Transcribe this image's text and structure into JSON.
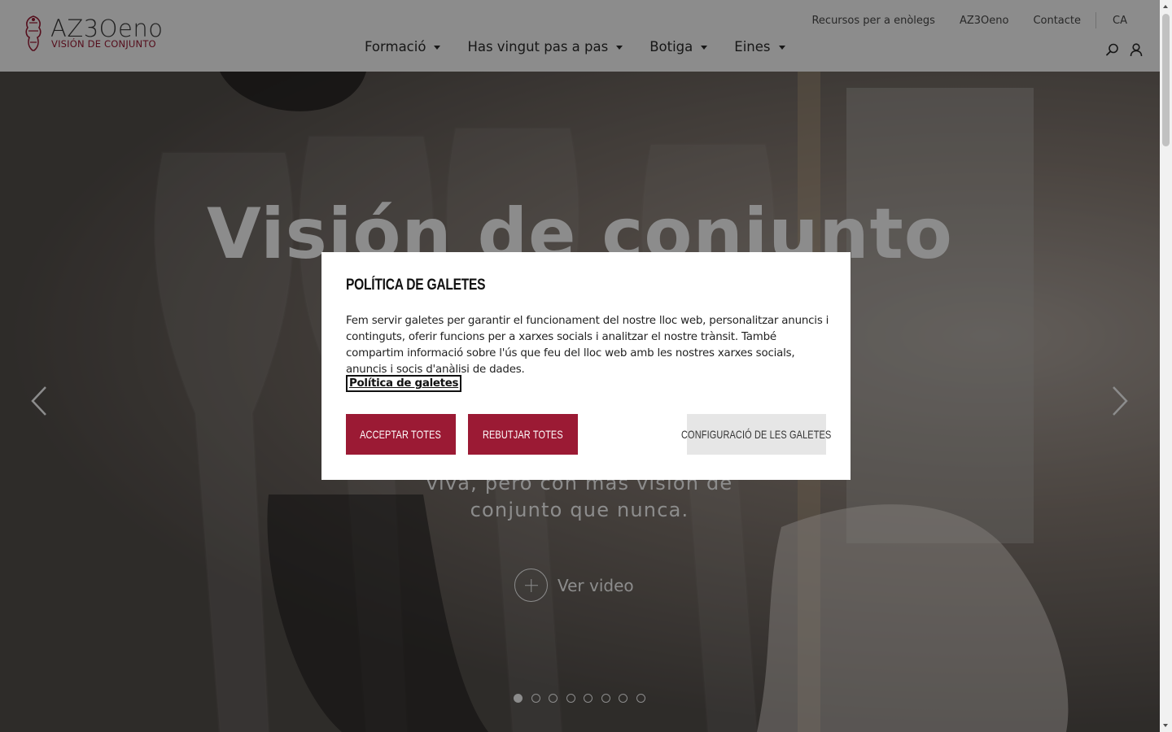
{
  "header": {
    "logo": {
      "word": "AZ3Oeno",
      "tagline": "VISIÓN DE CONJUNTO"
    },
    "top_links": [
      {
        "label": "Recursos per a enòlegs"
      },
      {
        "label": "AZ3Oeno"
      },
      {
        "label": "Contacte"
      }
    ],
    "language": "CA",
    "nav": [
      {
        "label": "Formació"
      },
      {
        "label": "Has vingut pas a pas"
      },
      {
        "label": "Botiga"
      },
      {
        "label": "Eines"
      }
    ],
    "icons": [
      "search-icon",
      "user-icon"
    ]
  },
  "hero": {
    "title": "Visión de conjunto",
    "text": "viva, pero con más visión de conjunto que nunca.",
    "video_label": "Ver video",
    "slide_count": 8,
    "active_slide": 1
  },
  "cookie_modal": {
    "title": "POLÍTICA DE GALETES",
    "body": "Fem servir galetes per garantir el funcionament del nostre lloc web, personalitzar anuncis i continguts, oferir funcions per a xarxes socials i analitzar el nostre trànsit. També compartim informació sobre l'ús que feu del lloc web amb les nostres xarxes socials, anuncis i socis d'anàlisi de dades.",
    "policy_link": "Política de galetes",
    "accept_label": "ACCEPTAR TOTES",
    "reject_label": "REBUTJAR TOTES",
    "config_label": "CONFIGURACIÓ DE LES GALETES"
  },
  "colors": {
    "brand": "#9b1a34",
    "config_button": "#e6e6e6"
  }
}
